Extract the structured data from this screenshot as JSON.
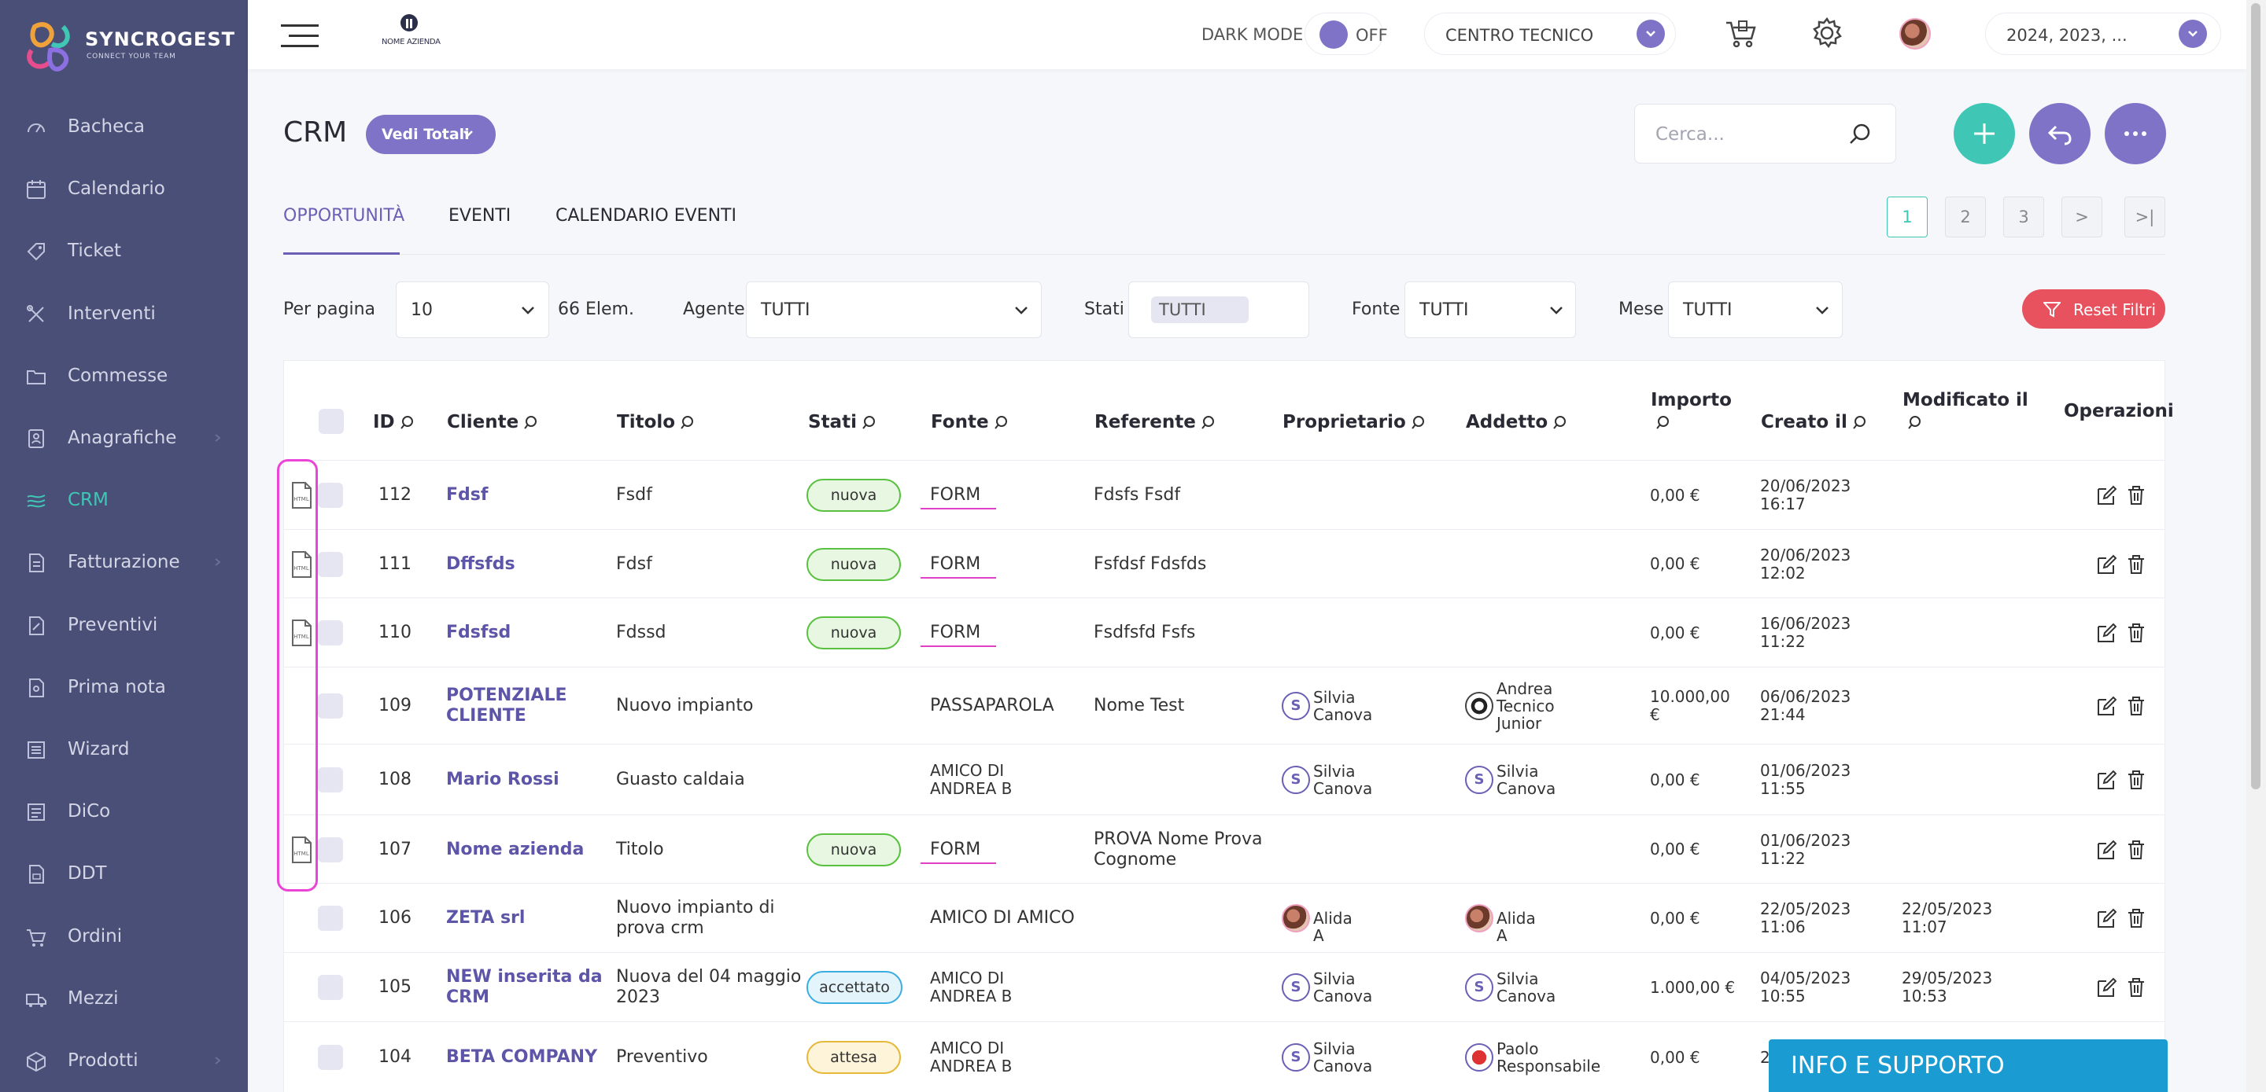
{
  "brand": {
    "name": "SYNCROGEST",
    "tagline": "CONNECT YOUR TEAM"
  },
  "sidebar": {
    "items": [
      {
        "label": "Bacheca",
        "icon": "dashboard-icon"
      },
      {
        "label": "Calendario",
        "icon": "calendar-icon"
      },
      {
        "label": "Ticket",
        "icon": "ticket-icon"
      },
      {
        "label": "Interventi",
        "icon": "tools-icon"
      },
      {
        "label": "Commesse",
        "icon": "folder-icon"
      },
      {
        "label": "Anagrafiche",
        "icon": "contacts-icon",
        "expandable": true
      },
      {
        "label": "CRM",
        "icon": "crm-icon",
        "active": true
      },
      {
        "label": "Fatturazione",
        "icon": "invoice-icon",
        "expandable": true
      },
      {
        "label": "Preventivi",
        "icon": "quote-icon"
      },
      {
        "label": "Prima nota",
        "icon": "ledger-icon"
      },
      {
        "label": "Wizard",
        "icon": "wizard-icon"
      },
      {
        "label": "DiCo",
        "icon": "dico-icon"
      },
      {
        "label": "DDT",
        "icon": "ddt-icon"
      },
      {
        "label": "Ordini",
        "icon": "cart-icon"
      },
      {
        "label": "Mezzi",
        "icon": "truck-icon"
      },
      {
        "label": "Prodotti",
        "icon": "product-icon",
        "expandable": true
      }
    ]
  },
  "topbar": {
    "company_logo_text": "NOME AZIENDA",
    "dark_mode_label": "DARK MODE",
    "dark_mode_state": "OFF",
    "center": "CENTRO TECNICO",
    "years": "2024, 2023, ..."
  },
  "page": {
    "title": "CRM",
    "totals_button": "Vedi Totali",
    "search_placeholder": "Cerca..."
  },
  "tabs": [
    "OPPORTUNITÀ",
    "EVENTI",
    "CALENDARIO EVENTI"
  ],
  "pagination": [
    "1",
    "2",
    "3",
    ">",
    ">|"
  ],
  "filters": {
    "per_page_label": "Per pagina",
    "per_page": "10",
    "count": "66 Elem.",
    "agent_label": "Agente",
    "agent": "TUTTI",
    "stati_label": "Stati",
    "stati": "TUTTI",
    "fonte_label": "Fonte",
    "fonte": "TUTTI",
    "mese_label": "Mese",
    "mese": "TUTTI",
    "reset": "Reset Filtri"
  },
  "table": {
    "headers": {
      "id": "ID",
      "cliente": "Cliente",
      "titolo": "Titolo",
      "stati": "Stati",
      "fonte": "Fonte",
      "referente": "Referente",
      "proprietario": "Proprietario",
      "addetto": "Addetto",
      "importo": "Importo",
      "creato": "Creato il",
      "modificato": "Modificato il",
      "operazioni": "Operazioni"
    },
    "rows": [
      {
        "id": "112",
        "cliente": [
          "Fdsf"
        ],
        "titolo": [
          "Fsdf"
        ],
        "stato": "nuova",
        "fonte": [
          "FORM"
        ],
        "referente": [
          "Fdsfs Fsdf"
        ],
        "proprietario": null,
        "addetto": null,
        "importo": [
          "0,00 €"
        ],
        "creato": [
          "20/06/2023",
          "16:17"
        ],
        "modificato": [],
        "html": true
      },
      {
        "id": "111",
        "cliente": [
          "Dffsfds"
        ],
        "titolo": [
          "Fdsf"
        ],
        "stato": "nuova",
        "fonte": [
          "FORM"
        ],
        "referente": [
          "Fsfdsf Fdsfds"
        ],
        "proprietario": null,
        "addetto": null,
        "importo": [
          "0,00 €"
        ],
        "creato": [
          "20/06/2023",
          "12:02"
        ],
        "modificato": [],
        "html": true
      },
      {
        "id": "110",
        "cliente": [
          "Fdsfsd"
        ],
        "titolo": [
          "Fdssd"
        ],
        "stato": "nuova",
        "fonte": [
          "FORM"
        ],
        "referente": [
          "Fsdfsfd Fsfs"
        ],
        "proprietario": null,
        "addetto": null,
        "importo": [
          "0,00 €"
        ],
        "creato": [
          "16/06/2023",
          "11:22"
        ],
        "modificato": [],
        "html": true
      },
      {
        "id": "109",
        "cliente": [
          "POTENZIALE",
          "CLIENTE"
        ],
        "titolo": [
          "Nuovo impianto"
        ],
        "stato": "",
        "fonte": [
          "PASSAPAROLA"
        ],
        "referente": [
          "Nome Test"
        ],
        "proprietario": {
          "initial": "S",
          "name": [
            "Silvia",
            "Canova"
          ],
          "avatar": "letter"
        },
        "addetto": {
          "initial": "",
          "name": [
            "Andrea",
            "Tecnico",
            "Junior"
          ],
          "avatar": "ball"
        },
        "importo": [
          "10.000,00",
          "€"
        ],
        "creato": [
          "06/06/2023",
          "21:44"
        ],
        "modificato": [],
        "html": false
      },
      {
        "id": "108",
        "cliente": [
          "Mario Rossi"
        ],
        "titolo": [
          "Guasto caldaia"
        ],
        "stato": "",
        "fonte": [
          "AMICO DI",
          "ANDREA B"
        ],
        "referente": [],
        "proprietario": {
          "initial": "S",
          "name": [
            "Silvia",
            "Canova"
          ],
          "avatar": "letter"
        },
        "addetto": {
          "initial": "S",
          "name": [
            "Silvia",
            "Canova"
          ],
          "avatar": "letter"
        },
        "importo": [
          "0,00 €"
        ],
        "creato": [
          "01/06/2023",
          "11:55"
        ],
        "modificato": [],
        "html": false
      },
      {
        "id": "107",
        "cliente": [
          "Nome azienda"
        ],
        "titolo": [
          "Titolo"
        ],
        "stato": "nuova",
        "fonte": [
          "FORM"
        ],
        "referente": [
          "PROVA Nome Prova",
          "Cognome"
        ],
        "proprietario": null,
        "addetto": null,
        "importo": [
          "0,00 €"
        ],
        "creato": [
          "01/06/2023",
          "11:22"
        ],
        "modificato": [],
        "html": true
      },
      {
        "id": "106",
        "cliente": [
          "ZETA srl"
        ],
        "titolo": [
          "Nuovo impianto di",
          "prova crm"
        ],
        "stato": "",
        "fonte": [
          "AMICO DI AMICO"
        ],
        "referente": [],
        "proprietario": {
          "initial": "",
          "name": [
            "Alida A"
          ],
          "avatar": "photo"
        },
        "addetto": {
          "initial": "",
          "name": [
            "Alida A"
          ],
          "avatar": "photo"
        },
        "importo": [
          "0,00 €"
        ],
        "creato": [
          "22/05/2023",
          "11:06"
        ],
        "modificato": [
          "22/05/2023",
          "11:07"
        ],
        "html": false
      },
      {
        "id": "105",
        "cliente": [
          "NEW inserita da",
          "CRM"
        ],
        "titolo": [
          "Nuova del 04 maggio",
          "2023"
        ],
        "stato": "accettato",
        "fonte": [
          "AMICO DI",
          "ANDREA B"
        ],
        "referente": [],
        "proprietario": {
          "initial": "S",
          "name": [
            "Silvia",
            "Canova"
          ],
          "avatar": "letter"
        },
        "addetto": {
          "initial": "S",
          "name": [
            "Silvia",
            "Canova"
          ],
          "avatar": "letter"
        },
        "importo": [
          "1.000,00 €"
        ],
        "creato": [
          "04/05/2023",
          "10:55"
        ],
        "modificato": [
          "29/05/2023",
          "10:53"
        ],
        "html": false
      },
      {
        "id": "104",
        "cliente": [
          "BETA COMPANY"
        ],
        "titolo": [
          "Preventivo"
        ],
        "stato": "attesa",
        "fonte": [
          "AMICO DI",
          "ANDREA B"
        ],
        "referente": [],
        "proprietario": {
          "initial": "S",
          "name": [
            "Silvia",
            "Canova"
          ],
          "avatar": "letter"
        },
        "addetto": {
          "initial": "",
          "name": [
            "Paolo",
            "Responsabile"
          ],
          "avatar": "red"
        },
        "importo": [
          "0,00 €"
        ],
        "creato": [
          "2"
        ],
        "modificato": [],
        "html": false
      }
    ]
  },
  "support": {
    "label": "INFO E SUPPORTO"
  },
  "colors": {
    "sidebar": "#4a4f77",
    "accent": "#7e73c7",
    "teal": "#3fc6b5",
    "danger": "#e8525f",
    "link": "#5c55a8",
    "support": "#1a9bd1"
  }
}
